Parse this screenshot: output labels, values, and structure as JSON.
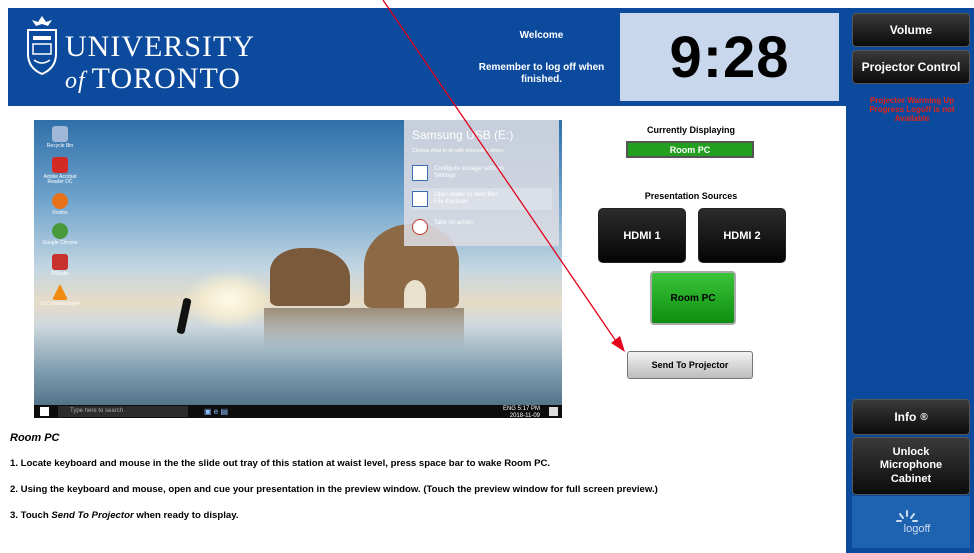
{
  "header": {
    "university_line1": "UNIVERSITY",
    "university_of": "of",
    "university_line2": "TORONTO",
    "welcome": "Welcome",
    "reminder": "Remember to log off when finished.",
    "clock": "9:28"
  },
  "sidebar": {
    "volume_label": "Volume",
    "projector_control_label": "Projector Control",
    "warning_text": "Projector Warming Up Progress Logoff is not Available",
    "info_label": "Info",
    "unlock_label": "Unlock Microphone Cabinet",
    "logoff_label": "logoff"
  },
  "preview": {
    "usb_title": "Samsung USB (E:)",
    "usb_subtitle": "Choose what to do with removable drives.",
    "usb_options": [
      {
        "text": "Configure storage settings",
        "sub": "Settings"
      },
      {
        "text": "Open folder to view files",
        "sub": "File Explorer"
      },
      {
        "text": "Take no action",
        "sub": ""
      }
    ],
    "desktop_icons": [
      {
        "label": "Recycle Bin",
        "color": "#9fb8d8"
      },
      {
        "label": "Adobe Acrobat Reader DC",
        "color": "#d32b23"
      },
      {
        "label": "Firefox",
        "color": "#e8721c"
      },
      {
        "label": "Google Chrome",
        "color": "#4a9a3d"
      },
      {
        "label": "RStudio",
        "color": "#c8322c"
      },
      {
        "label": "VLC media player",
        "color": "#f08a10"
      }
    ],
    "search_placeholder": "Type here to search",
    "tray_time": "5:17 PM",
    "tray_date": "2018-11-09",
    "tray_lang": "ENG"
  },
  "control": {
    "currently_displaying_label": "Currently Displaying",
    "currently_displaying_value": "Room PC",
    "presentation_sources_label": "Presentation Sources",
    "hdmi1_label": "HDMI 1",
    "hdmi2_label": "HDMI 2",
    "roompc_label": "Room PC",
    "send_label": "Send To Projector"
  },
  "instructions": {
    "title": "Room PC",
    "step1": "1. Locate keyboard and mouse in the the slide out tray of this station at waist level, press space bar to wake Room PC.",
    "step2": "2. Using the keyboard and mouse, open and cue your presentation in the preview window. (Touch the preview window for full screen preview.)",
    "step3_prefix": "3. Touch ",
    "step3_em": "Send To Projector",
    "step3_suffix": " when ready to display."
  },
  "colors": {
    "brand_blue": "#0b4a9c",
    "active_green": "#239f1f",
    "warning_red": "#e2231a"
  }
}
